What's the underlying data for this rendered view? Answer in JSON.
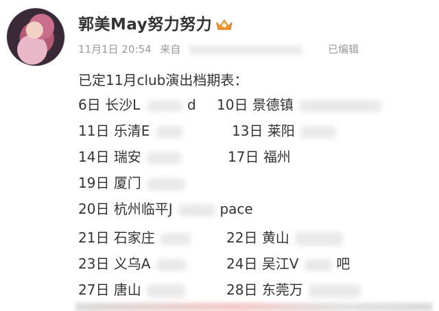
{
  "post": {
    "username": "郭美May努力努力",
    "timestamp": "11月1日 20:54",
    "source_prefix": "来自",
    "edited_label": "已编辑",
    "title": "已定11月club演出档期表："
  },
  "schedule": [
    {
      "date": "6日",
      "text": "长沙L",
      "tail": "d"
    },
    {
      "date": "10日",
      "text": "景德镇",
      "tail": ""
    },
    {
      "date": "11日",
      "text": "乐清E",
      "tail": ""
    },
    {
      "date": "13日",
      "text": "莱阳",
      "tail": ""
    },
    {
      "date": "14日",
      "text": "瑞安",
      "tail": ""
    },
    {
      "date": "17日",
      "text": "福州",
      "tail": ""
    },
    {
      "date": "19日",
      "text": "厦门",
      "tail": ""
    },
    {
      "date": "20日",
      "text": "杭州临平J",
      "tail": "pace"
    },
    {
      "date": "21日",
      "text": "石家庄",
      "tail": ""
    },
    {
      "date": "22日",
      "text": "黄山",
      "tail": ""
    },
    {
      "date": "23日",
      "text": "义乌A",
      "tail": ""
    },
    {
      "date": "24日",
      "text": "吴江V",
      "tail": "吧"
    },
    {
      "date": "27日",
      "text": "唐山",
      "tail": ""
    },
    {
      "date": "28日",
      "text": "东莞万",
      "tail": ""
    }
  ],
  "icons": {
    "verified": "crown-badge-icon"
  },
  "colors": {
    "text": "#333333",
    "meta": "#9a9a9a",
    "badge": "#f0a33a"
  }
}
